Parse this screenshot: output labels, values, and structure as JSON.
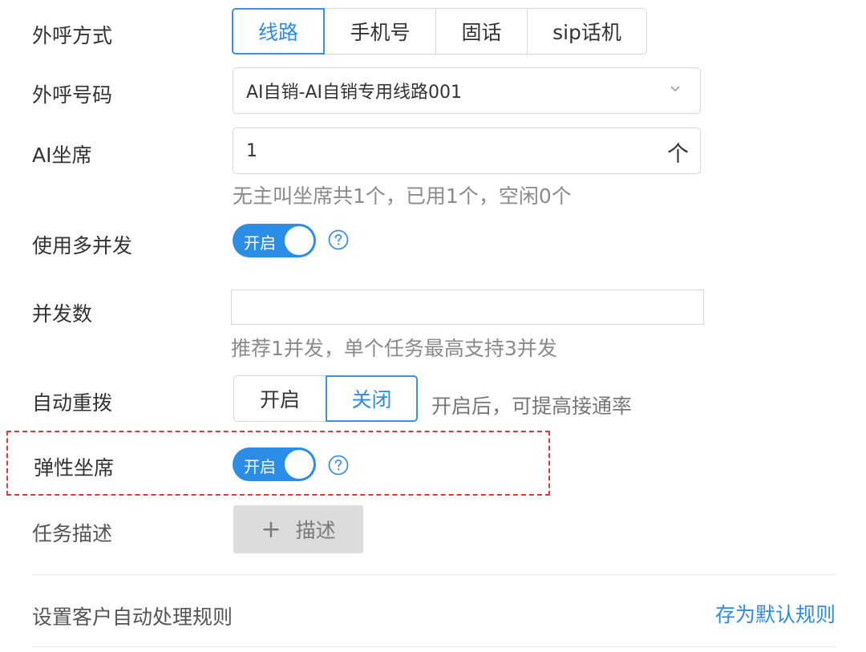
{
  "call_method": {
    "label": "外呼方式",
    "options": [
      "线路",
      "手机号",
      "固话",
      "sip话机"
    ],
    "selected": "线路"
  },
  "call_number": {
    "label": "外呼号码",
    "value": "AI自销-AI自销专用线路001"
  },
  "ai_seat": {
    "label": "AI坐席",
    "value": "1",
    "unit": "个",
    "hint": "无主叫坐席共1个，已用1个，空闲0个"
  },
  "multi_concurrency": {
    "label": "使用多并发",
    "toggle_text": "开启",
    "enabled": true
  },
  "concurrency_count": {
    "label": "并发数",
    "value": "",
    "hint": "推荐1并发，单个任务最高支持3并发"
  },
  "auto_redial": {
    "label": "自动重拨",
    "options": [
      "开启",
      "关闭"
    ],
    "selected": "关闭",
    "hint": "开启后，可提高接通率"
  },
  "elastic_seat": {
    "label": "弹性坐席",
    "toggle_text": "开启",
    "enabled": true
  },
  "task_desc": {
    "label": "任务描述",
    "button_icon": "+",
    "button_label": "描述"
  },
  "rules": {
    "title": "设置客户自动处理规则",
    "save_link": "存为默认规则"
  },
  "colors": {
    "accent": "#2f8ae3",
    "highlight_border": "#d93a3a"
  }
}
